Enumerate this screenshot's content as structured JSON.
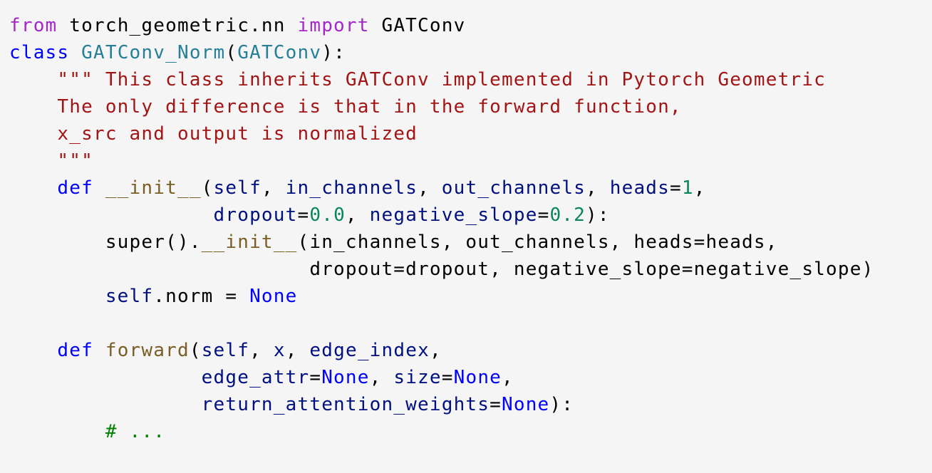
{
  "code": {
    "lines": [
      [
        {
          "t": "from",
          "c": "kw-import"
        },
        {
          "t": " torch_geometric.nn ",
          "c": "plain"
        },
        {
          "t": "import",
          "c": "kw-import"
        },
        {
          "t": " GATConv",
          "c": "plain"
        }
      ],
      [
        {
          "t": "class",
          "c": "kw-class"
        },
        {
          "t": " ",
          "c": "plain"
        },
        {
          "t": "GATConv_Norm",
          "c": "cls"
        },
        {
          "t": "(",
          "c": "plain"
        },
        {
          "t": "GATConv",
          "c": "cls"
        },
        {
          "t": "):",
          "c": "plain"
        }
      ],
      [
        {
          "t": "    \"\"\" This class inherits GATConv implemented in Pytorch Geometric",
          "c": "str"
        }
      ],
      [
        {
          "t": "    The only difference is that in the forward function,",
          "c": "str"
        }
      ],
      [
        {
          "t": "    x_src and output is normalized",
          "c": "str"
        }
      ],
      [
        {
          "t": "    \"\"\"",
          "c": "str"
        }
      ],
      [
        {
          "t": "    ",
          "c": "plain"
        },
        {
          "t": "def",
          "c": "kw-def"
        },
        {
          "t": " ",
          "c": "plain"
        },
        {
          "t": "__init__",
          "c": "fn"
        },
        {
          "t": "(",
          "c": "plain"
        },
        {
          "t": "self",
          "c": "param"
        },
        {
          "t": ", ",
          "c": "plain"
        },
        {
          "t": "in_channels",
          "c": "param"
        },
        {
          "t": ", ",
          "c": "plain"
        },
        {
          "t": "out_channels",
          "c": "param"
        },
        {
          "t": ", ",
          "c": "plain"
        },
        {
          "t": "heads",
          "c": "param"
        },
        {
          "t": "=",
          "c": "plain"
        },
        {
          "t": "1",
          "c": "num"
        },
        {
          "t": ",",
          "c": "plain"
        }
      ],
      [
        {
          "t": "                 ",
          "c": "plain"
        },
        {
          "t": "dropout",
          "c": "param"
        },
        {
          "t": "=",
          "c": "plain"
        },
        {
          "t": "0.0",
          "c": "num"
        },
        {
          "t": ", ",
          "c": "plain"
        },
        {
          "t": "negative_slope",
          "c": "param"
        },
        {
          "t": "=",
          "c": "plain"
        },
        {
          "t": "0.2",
          "c": "num"
        },
        {
          "t": "):",
          "c": "plain"
        }
      ],
      [
        {
          "t": "        super().",
          "c": "plain"
        },
        {
          "t": "__init__",
          "c": "fn"
        },
        {
          "t": "(in_channels, out_channels, heads=heads,",
          "c": "plain"
        }
      ],
      [
        {
          "t": "                         dropout=dropout, negative_slope=negative_slope)",
          "c": "plain"
        }
      ],
      [
        {
          "t": "        ",
          "c": "plain"
        },
        {
          "t": "self",
          "c": "param"
        },
        {
          "t": ".norm = ",
          "c": "plain"
        },
        {
          "t": "None",
          "c": "const"
        }
      ],
      [
        {
          "t": "",
          "c": "plain"
        }
      ],
      [
        {
          "t": "    ",
          "c": "plain"
        },
        {
          "t": "def",
          "c": "kw-def"
        },
        {
          "t": " ",
          "c": "plain"
        },
        {
          "t": "forward",
          "c": "fn"
        },
        {
          "t": "(",
          "c": "plain"
        },
        {
          "t": "self",
          "c": "param"
        },
        {
          "t": ", ",
          "c": "plain"
        },
        {
          "t": "x",
          "c": "param"
        },
        {
          "t": ", ",
          "c": "plain"
        },
        {
          "t": "edge_index",
          "c": "param"
        },
        {
          "t": ",",
          "c": "plain"
        }
      ],
      [
        {
          "t": "                ",
          "c": "plain"
        },
        {
          "t": "edge_attr",
          "c": "param"
        },
        {
          "t": "=",
          "c": "plain"
        },
        {
          "t": "None",
          "c": "const"
        },
        {
          "t": ", ",
          "c": "plain"
        },
        {
          "t": "size",
          "c": "param"
        },
        {
          "t": "=",
          "c": "plain"
        },
        {
          "t": "None",
          "c": "const"
        },
        {
          "t": ",",
          "c": "plain"
        }
      ],
      [
        {
          "t": "                ",
          "c": "plain"
        },
        {
          "t": "return_attention_weights",
          "c": "param"
        },
        {
          "t": "=",
          "c": "plain"
        },
        {
          "t": "None",
          "c": "const"
        },
        {
          "t": "):",
          "c": "plain"
        }
      ],
      [
        {
          "t": "        ",
          "c": "plain"
        },
        {
          "t": "# ...",
          "c": "comment"
        }
      ]
    ]
  },
  "colors": {
    "background": "#f5f5f5",
    "keyword_import": "#a626c9",
    "keyword": "#0000ff",
    "class_name": "#267f99",
    "function_name": "#795e26",
    "parameter": "#001080",
    "number": "#098658",
    "string": "#a31515",
    "comment": "#008000"
  }
}
